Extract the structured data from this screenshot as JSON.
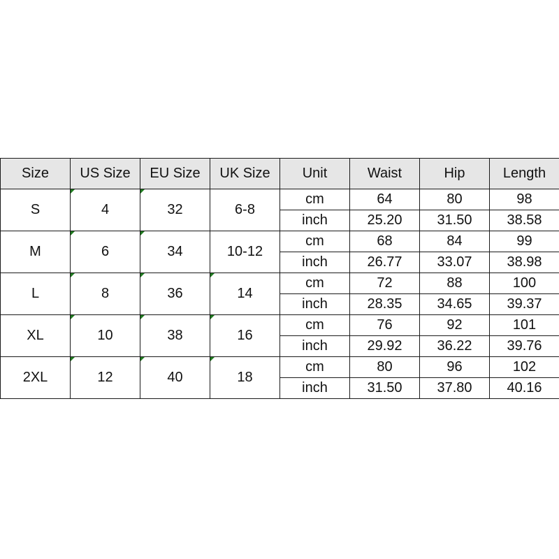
{
  "headers": [
    "Size",
    "US Size",
    "EU Size",
    "UK Size",
    "Unit",
    "Waist",
    "Hip",
    "Length"
  ],
  "accent_marker_color": "#1f7a1f",
  "rows": [
    {
      "size": "S",
      "us": "4",
      "eu": "32",
      "uk": "6-8",
      "cm": {
        "unit": "cm",
        "waist": "64",
        "hip": "80",
        "length": "98"
      },
      "inch": {
        "unit": "inch",
        "waist": "25.20",
        "hip": "31.50",
        "length": "38.58"
      }
    },
    {
      "size": "M",
      "us": "6",
      "eu": "34",
      "uk": "10-12",
      "cm": {
        "unit": "cm",
        "waist": "68",
        "hip": "84",
        "length": "99"
      },
      "inch": {
        "unit": "inch",
        "waist": "26.77",
        "hip": "33.07",
        "length": "38.98"
      }
    },
    {
      "size": "L",
      "us": "8",
      "eu": "36",
      "uk": "14",
      "cm": {
        "unit": "cm",
        "waist": "72",
        "hip": "88",
        "length": "100"
      },
      "inch": {
        "unit": "inch",
        "waist": "28.35",
        "hip": "34.65",
        "length": "39.37"
      }
    },
    {
      "size": "XL",
      "us": "10",
      "eu": "38",
      "uk": "16",
      "cm": {
        "unit": "cm",
        "waist": "76",
        "hip": "92",
        "length": "101"
      },
      "inch": {
        "unit": "inch",
        "waist": "29.92",
        "hip": "36.22",
        "length": "39.76"
      }
    },
    {
      "size": "2XL",
      "us": "12",
      "eu": "40",
      "uk": "18",
      "cm": {
        "unit": "cm",
        "waist": "80",
        "hip": "96",
        "length": "102"
      },
      "inch": {
        "unit": "inch",
        "waist": "31.50",
        "hip": "37.80",
        "length": "40.16"
      }
    }
  ]
}
